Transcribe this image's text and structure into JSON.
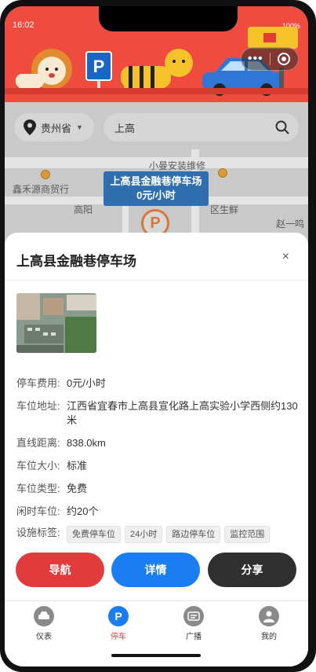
{
  "status": {
    "time": "16:02",
    "battery": "100%"
  },
  "capsule": {
    "more": "•••"
  },
  "banner": {
    "parking_sign": "P"
  },
  "search": {
    "province": "贵州省",
    "query": "上高"
  },
  "map": {
    "labels": [
      "小曼安装维修",
      "鑫禾源商贸行",
      "高阳",
      "区生鲜",
      "赵一鸣"
    ],
    "callout_name": "上高县金融巷停车场",
    "callout_price": "0元/小时",
    "pin_letter": "P"
  },
  "sheet": {
    "title": "上高县金融巷停车场",
    "close": "×",
    "fields": [
      {
        "label": "停车费用:",
        "value": "0元/小时"
      },
      {
        "label": "车位地址:",
        "value": "江西省宜春市上高县宣化路上高实验小学西侧约130米"
      },
      {
        "label": "直线距离:",
        "value": "838.0km"
      },
      {
        "label": "车位大小:",
        "value": "标准"
      },
      {
        "label": "车位类型:",
        "value": "免费"
      },
      {
        "label": "闲时车位:",
        "value": "约20个"
      }
    ],
    "tags_label": "设施标签:",
    "tags": [
      "免费停车位",
      "24小时",
      "路边停车位",
      "监控范围"
    ],
    "buttons": {
      "navigate": "导航",
      "detail": "详情",
      "share": "分享"
    }
  },
  "tabbar": {
    "items": [
      {
        "label": "仪表",
        "active": false
      },
      {
        "label": "停车",
        "active": true
      },
      {
        "label": "广播",
        "active": false
      },
      {
        "label": "我的",
        "active": false
      }
    ]
  },
  "colors": {
    "banner": "#ef4b3f",
    "accent_blue": "#1a7ef2",
    "accent_red": "#e03c3c",
    "dark": "#2f2f2f"
  }
}
